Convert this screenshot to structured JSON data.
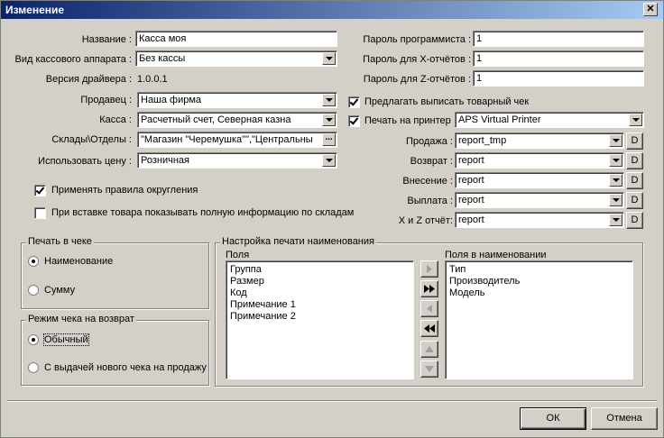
{
  "window": {
    "title": "Изменение",
    "close_glyph": "✕"
  },
  "left": {
    "name": {
      "label": "Название :",
      "value": "Касса моя"
    },
    "device_type": {
      "label": "Вид кассового аппарата :",
      "value": "Без кассы"
    },
    "driver_version": {
      "label": "Версия драйвера :",
      "value": "1.0.0.1"
    },
    "seller": {
      "label": "Продавец :",
      "value": "Наша фирма"
    },
    "cash": {
      "label": "Касса :",
      "value": "Расчетный счет, Северная казна"
    },
    "warehouses": {
      "label": "Склады\\Отделы :",
      "value": "\"Магазин \"Черемушка\"\",\"Центральны",
      "ellipsis": "..."
    },
    "price": {
      "label": "Использовать цену :",
      "value": "Розничная"
    },
    "rounding": {
      "label": "Применять правила округления",
      "checked": true
    },
    "full_info": {
      "label": "При вставке товара показывать полную информацию по складам",
      "checked": false
    }
  },
  "right": {
    "programmer_password": {
      "label": "Пароль программиста :",
      "value": "1"
    },
    "x_password": {
      "label": "Пароль для X-отчётов :",
      "value": "1"
    },
    "z_password": {
      "label": "Пароль для Z-отчётов :",
      "value": "1"
    },
    "offer_receipt": {
      "label": "Предлагать выписать товарный чек",
      "checked": true
    },
    "print_to_printer": {
      "label": "Печать на принтер",
      "checked": true,
      "value": "APS Virtual Printer"
    },
    "reports": [
      {
        "label": "Продажа :",
        "value": "report_tmp",
        "d": "D"
      },
      {
        "label": "Возврат :",
        "value": "report",
        "d": "D"
      },
      {
        "label": "Внесение :",
        "value": "report",
        "d": "D"
      },
      {
        "label": "Выплата :",
        "value": "report",
        "d": "D"
      },
      {
        "label": "X и Z отчёт:",
        "value": "report",
        "d": "D"
      }
    ]
  },
  "print_in_receipt": {
    "title": "Печать в чеке",
    "options": [
      {
        "label": "Наименование",
        "checked": true
      },
      {
        "label": "Сумму",
        "checked": false
      }
    ]
  },
  "return_mode": {
    "title": "Режим чека на возврат",
    "options": [
      {
        "label": "Обычный",
        "checked": true
      },
      {
        "label": "С выдачей нового чека на продажу",
        "checked": false
      }
    ]
  },
  "name_print": {
    "title": "Настройка печати наименования",
    "fields_label": "Поля",
    "fields": [
      "Группа",
      "Размер",
      "Код",
      "Примечание 1",
      "Примечание 2"
    ],
    "name_fields_label": "Поля в наименовании",
    "name_fields": [
      "Тип",
      "Производитель",
      "Модель"
    ]
  },
  "buttons": {
    "ok": "ОК",
    "cancel": "Отмена"
  }
}
